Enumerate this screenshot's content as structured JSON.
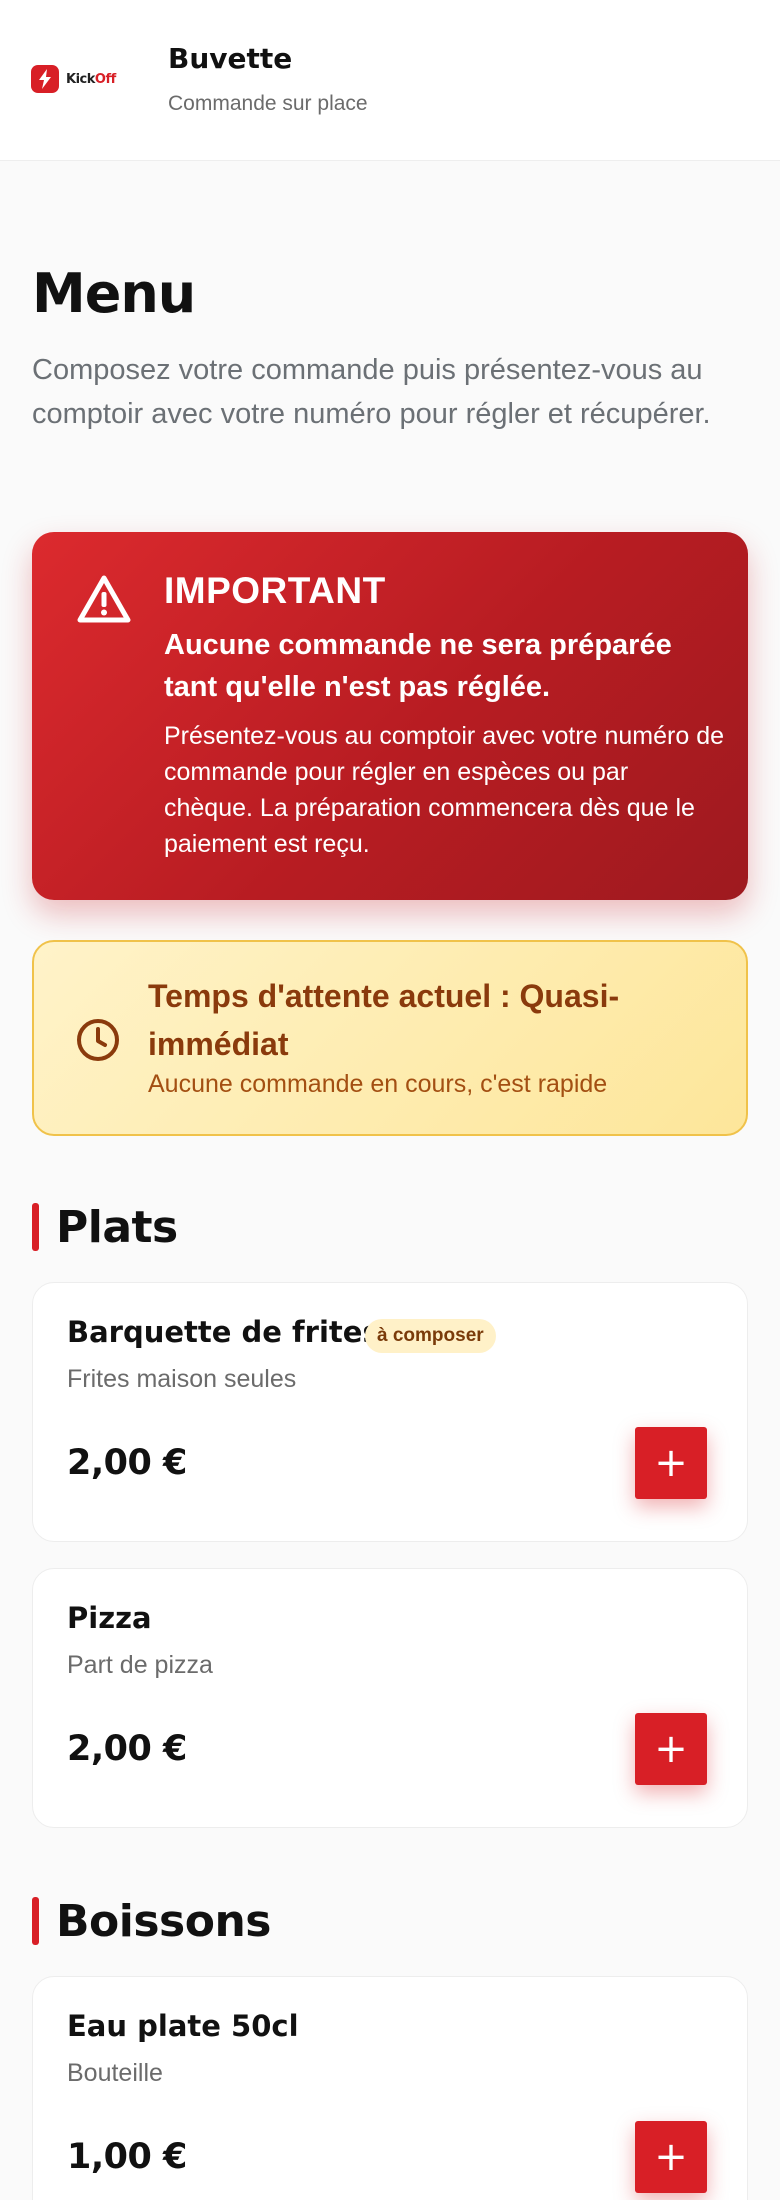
{
  "header": {
    "logo_text_a": "Kick",
    "logo_text_b": "Off",
    "title": "Buvette",
    "subtitle": "Commande sur place"
  },
  "intro": {
    "title": "Menu",
    "description": "Composez votre commande puis présentez-vous au comptoir avec votre numéro pour régler et récupérer."
  },
  "alert": {
    "icon": "warning-icon",
    "title": "IMPORTANT",
    "lead": "Aucune commande ne sera préparée tant qu'elle n'est pas réglée.",
    "body": "Présentez-vous au comptoir avec votre numéro de commande pour régler en espèces ou par chèque. La préparation commencera dès que le paiement est reçu.",
    "color": "#d81f26"
  },
  "wait": {
    "icon": "clock-icon",
    "title": "Temps d'attente actuel : Quasi-immédiat",
    "subtitle": "Aucune commande en cours, c'est rapide"
  },
  "sections": [
    {
      "title": "Plats",
      "items": [
        {
          "name": "Barquette de frites",
          "badge": "à composer",
          "description": "Frites maison seules",
          "price": "2,00 €",
          "add_label": "+"
        },
        {
          "name": "Pizza",
          "description": "Part de pizza",
          "price": "2,00 €",
          "add_label": "+"
        }
      ]
    },
    {
      "title": "Boissons",
      "items": [
        {
          "name": "Eau plate 50cl",
          "description": "Bouteille",
          "price": "1,00 €",
          "add_label": "+"
        }
      ]
    }
  ],
  "colors": {
    "accent": "#d81f26",
    "warning_bg": "#fde69a",
    "warning_text": "#8a3a0c"
  }
}
